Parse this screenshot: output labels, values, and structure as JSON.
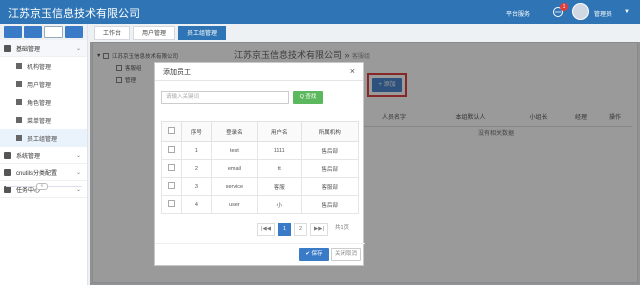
{
  "app": {
    "title": "江苏京玉信息技术有限公司",
    "service": "平台服务",
    "notification_count": "1",
    "user_name": "管理员"
  },
  "sidebar": {
    "groups": [
      {
        "label": "基础管理",
        "icon": "grid-icon"
      },
      {
        "label": "系统管理",
        "icon": "search-icon"
      },
      {
        "label": "cnutils分类配置",
        "icon": "gear-icon"
      },
      {
        "label": "任务中心",
        "icon": "bell-icon"
      }
    ],
    "items": [
      {
        "label": "机构管理"
      },
      {
        "label": "用户管理"
      },
      {
        "label": "角色管理"
      },
      {
        "label": "菜单管理"
      },
      {
        "label": "员工组管理"
      }
    ]
  },
  "tabs": [
    {
      "label": "工作台"
    },
    {
      "label": "用户管理"
    },
    {
      "label": "员工组管理"
    }
  ],
  "tree": {
    "root": "江苏京玉信息技术有限公司",
    "children": [
      {
        "label": "客服组"
      },
      {
        "label": "管理"
      }
    ]
  },
  "breadcrumb": {
    "company": "江苏京玉信息技术有限公司 »",
    "group": "客服组"
  },
  "toolbar": {
    "add_label": "+ 添加"
  },
  "main_table": {
    "headers": [
      "人员名字",
      "本组默认人",
      "小组长",
      "经理",
      "操作"
    ],
    "empty": "没有相关数据"
  },
  "modal": {
    "title": "添加员工",
    "search_placeholder": "请输入关键词",
    "search_label": "Q 查找",
    "headers": [
      "序号",
      "登录名",
      "用户名",
      "所属机构"
    ],
    "rows": [
      {
        "no": "1",
        "login": "test",
        "name": "1111",
        "org": "售后部"
      },
      {
        "no": "2",
        "login": "email",
        "name": "tt",
        "org": "售后部"
      },
      {
        "no": "3",
        "login": "service",
        "name": "客服",
        "org": "客服部"
      },
      {
        "no": "4",
        "login": "user",
        "name": "小",
        "org": "售后部"
      }
    ],
    "pager": {
      "first": "|◀◀",
      "p1": "1",
      "p2": "2",
      "last": "▶▶|",
      "total": "共1页"
    },
    "ok_label": "✔ 保存",
    "cancel_label": "关闭取消"
  }
}
